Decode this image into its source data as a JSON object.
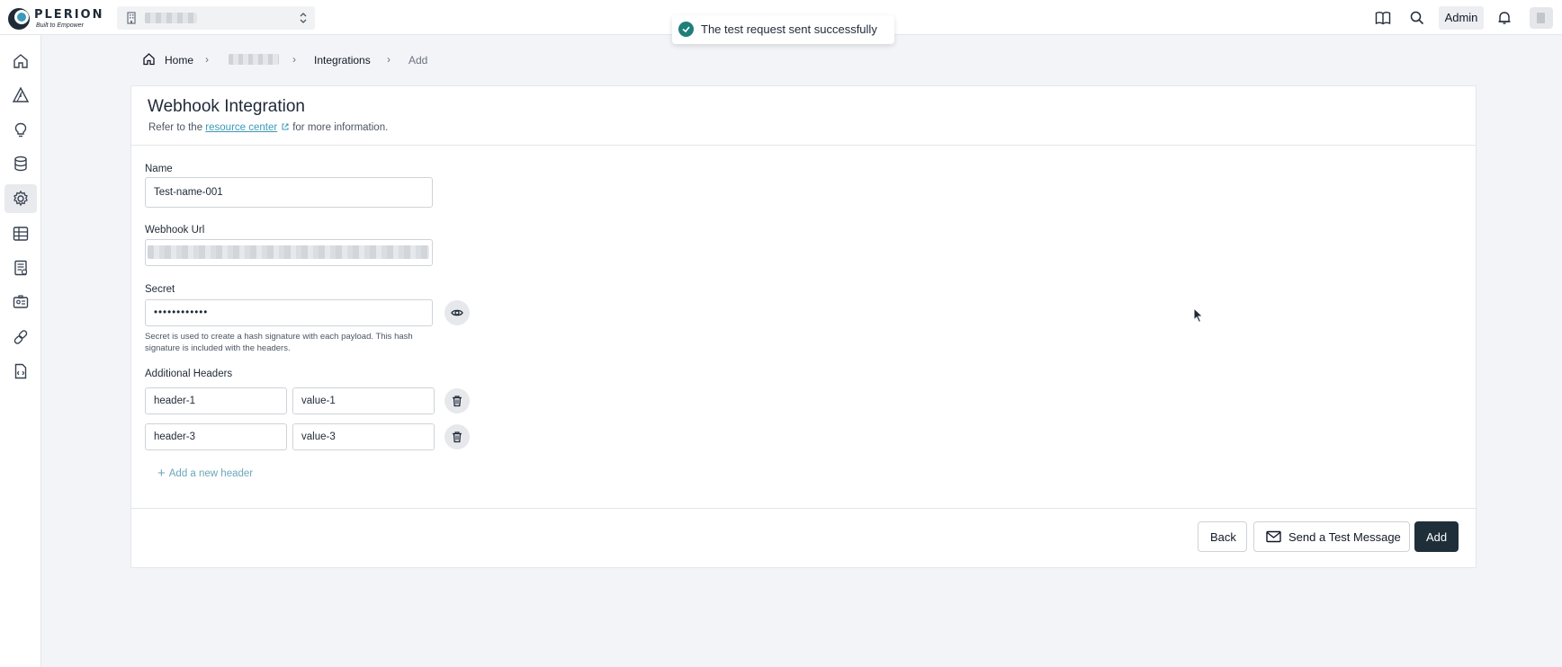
{
  "topbar": {
    "logo_text": "PLERION",
    "logo_tagline": "Built to Empower",
    "org_selector_icon": "building-icon",
    "toast_message": "The test request sent successfully",
    "admin_label": "Admin",
    "icons": [
      "book-icon",
      "search-icon",
      "bell-icon",
      "user-avatar-icon"
    ]
  },
  "sidebar": {
    "items": [
      "home-icon",
      "alert-triangle-icon",
      "lightbulb-icon",
      "database-icon",
      "gear-icon",
      "inventory-icon",
      "report-icon",
      "id-card-icon",
      "link-icon",
      "code-file-icon"
    ],
    "active_index": 4
  },
  "breadcrumb": {
    "home": "Home",
    "integrations": "Integrations",
    "current": "Add"
  },
  "form": {
    "title": "Webhook Integration",
    "subtitle_prefix": "Refer to the",
    "subtitle_link": "resource center",
    "subtitle_suffix": "for more information.",
    "name_label": "Name",
    "name_value": "Test-name-001",
    "url_label": "Webhook Url",
    "secret_label": "Secret",
    "secret_value": "••••••••••••",
    "secret_help": "Secret is used to create a hash signature with each payload. This hash signature is included with the headers.",
    "headers_label": "Additional Headers",
    "headers": [
      {
        "key": "header-1",
        "value": "value-1"
      },
      {
        "key": "header-3",
        "value": "value-3"
      }
    ],
    "add_header_label": "Add a new header"
  },
  "footer": {
    "back_label": "Back",
    "test_label": "Send a Test Message",
    "add_label": "Add"
  },
  "colors": {
    "primary": "#1f2f3a",
    "link": "#3b9ab8",
    "success": "#1e7f7a"
  }
}
